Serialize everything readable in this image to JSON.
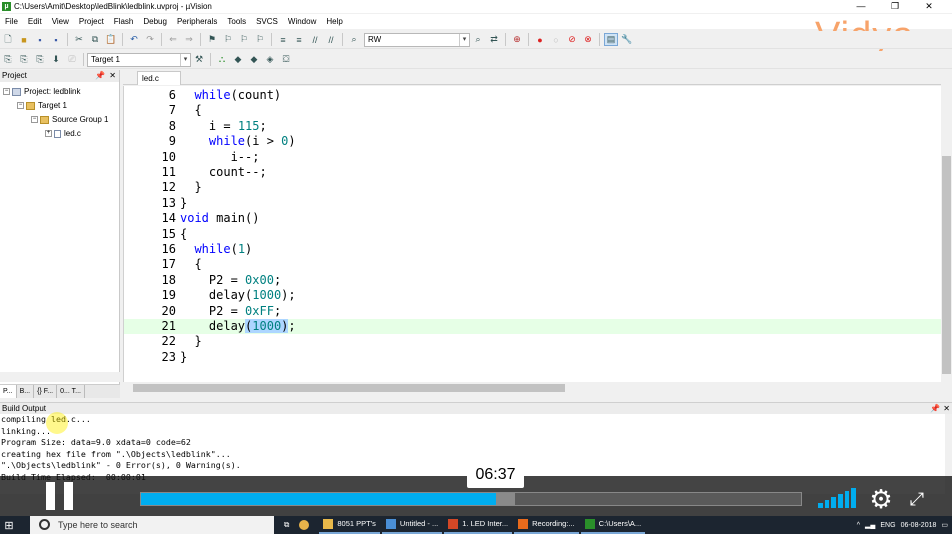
{
  "window": {
    "title": "C:\\Users\\Amit\\Desktop\\ledBlink\\ledblink.uvproj - µVision",
    "min": "—",
    "max": "❐",
    "close": "✕"
  },
  "menu": [
    "File",
    "Edit",
    "View",
    "Project",
    "Flash",
    "Debug",
    "Peripherals",
    "Tools",
    "SVCS",
    "Window",
    "Help"
  ],
  "toolbar": {
    "rw_label": "RW",
    "target_value": "Target 1"
  },
  "logo": "Vidya",
  "project_panel": {
    "title": "Project",
    "tree": [
      {
        "label": "Project: ledblink",
        "level": 0,
        "expander": "−"
      },
      {
        "label": "Target 1",
        "level": 1,
        "expander": "−"
      },
      {
        "label": "Source Group 1",
        "level": 2,
        "expander": "−"
      },
      {
        "label": "led.c",
        "level": 3,
        "expander": "+"
      }
    ],
    "tabs": [
      "P...",
      "B...",
      "{} F...",
      "0... T..."
    ]
  },
  "editor": {
    "tab": "led.c",
    "lines": [
      {
        "n": "6",
        "indent": "  ",
        "segs": [
          {
            "t": "while",
            "c": "kw"
          },
          {
            "t": "(count)"
          }
        ]
      },
      {
        "n": "7",
        "indent": "  ",
        "segs": [
          {
            "t": "{"
          }
        ]
      },
      {
        "n": "8",
        "indent": "    ",
        "segs": [
          {
            "t": "i = "
          },
          {
            "t": "115",
            "c": "num"
          },
          {
            "t": ";"
          }
        ]
      },
      {
        "n": "9",
        "indent": "    ",
        "segs": [
          {
            "t": "while",
            "c": "kw"
          },
          {
            "t": "(i > "
          },
          {
            "t": "0",
            "c": "num"
          },
          {
            "t": ")"
          }
        ]
      },
      {
        "n": "10",
        "indent": "       ",
        "segs": [
          {
            "t": "i--;"
          }
        ]
      },
      {
        "n": "11",
        "indent": "    ",
        "segs": [
          {
            "t": "count--;"
          }
        ]
      },
      {
        "n": "12",
        "indent": "  ",
        "segs": [
          {
            "t": "}"
          }
        ]
      },
      {
        "n": "13",
        "indent": "",
        "segs": [
          {
            "t": "}"
          }
        ]
      },
      {
        "n": "14",
        "indent": "",
        "segs": [
          {
            "t": "void",
            "c": "kw"
          },
          {
            "t": " main()"
          }
        ]
      },
      {
        "n": "15",
        "indent": "",
        "segs": [
          {
            "t": "{"
          }
        ]
      },
      {
        "n": "16",
        "indent": "  ",
        "segs": [
          {
            "t": "while",
            "c": "kw"
          },
          {
            "t": "("
          },
          {
            "t": "1",
            "c": "num"
          },
          {
            "t": ")"
          }
        ]
      },
      {
        "n": "17",
        "indent": "  ",
        "segs": [
          {
            "t": "{"
          }
        ]
      },
      {
        "n": "18",
        "indent": "    ",
        "segs": [
          {
            "t": "P2 = "
          },
          {
            "t": "0x00",
            "c": "num"
          },
          {
            "t": ";"
          }
        ]
      },
      {
        "n": "19",
        "indent": "    ",
        "segs": [
          {
            "t": "delay("
          },
          {
            "t": "1000",
            "c": "num"
          },
          {
            "t": ");"
          }
        ]
      },
      {
        "n": "20",
        "indent": "    ",
        "segs": [
          {
            "t": "P2 = "
          },
          {
            "t": "0xFF",
            "c": "num"
          },
          {
            "t": ";"
          }
        ]
      },
      {
        "n": "21",
        "indent": "    ",
        "hl": true,
        "segs": [
          {
            "t": "delay"
          },
          {
            "t": "(",
            "c": "sel"
          },
          {
            "t": "1000",
            "c": "num sel"
          },
          {
            "t": ")",
            "c": "sel"
          },
          {
            "t": ";"
          }
        ]
      },
      {
        "n": "22",
        "indent": "  ",
        "segs": [
          {
            "t": "}"
          }
        ]
      },
      {
        "n": "23",
        "indent": "",
        "segs": [
          {
            "t": "}"
          }
        ]
      }
    ]
  },
  "build_output": {
    "title": "Build Output",
    "lines": [
      "compiling led.c...",
      "linking...",
      "Program Size: data=9.0 xdata=0 code=62",
      "creating hex file from \".\\Objects\\ledblink\"...",
      "\".\\Objects\\ledblink\" - 0 Error(s), 0 Warning(s).",
      "Build Time Elapsed:  00:00:01"
    ]
  },
  "video": {
    "current_time": "06:37",
    "progress_fraction": 0.538,
    "buffered_fraction": 0.567
  },
  "taskbar": {
    "search_placeholder": "Type here to search",
    "tasks": [
      {
        "label": "8051 PPT's",
        "color": "#e8b84a"
      },
      {
        "label": "Untitled - ...",
        "color": "#4a8fd6"
      },
      {
        "label": "1. LED Inter...",
        "color": "#d24726"
      },
      {
        "label": "Recording:...",
        "color": "#e86a1c"
      },
      {
        "label": "C:\\Users\\A...",
        "color": "#2a8f2a"
      }
    ],
    "lang": "ENG",
    "date": "06-08-2018"
  }
}
